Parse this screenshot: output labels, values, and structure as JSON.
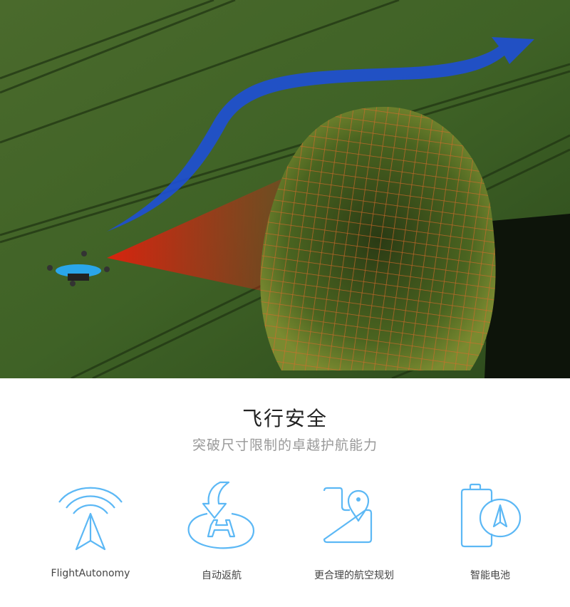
{
  "hero": {
    "accent_path_color": "#1e4fd6",
    "cone_color": "#c0281a",
    "grid_color": "#d86a2a",
    "drone_color": "#2aa6ea"
  },
  "section": {
    "title": "飞行安全",
    "subtitle": "突破尺寸限制的卓越护航能力"
  },
  "features": [
    {
      "icon": "flight-autonomy-icon",
      "label": "FlightAutonomy"
    },
    {
      "icon": "return-home-icon",
      "label": "自动返航"
    },
    {
      "icon": "route-planning-icon",
      "label": "更合理的航空规划"
    },
    {
      "icon": "smart-battery-icon",
      "label": "智能电池"
    }
  ],
  "icon_color": "#5cb8f5"
}
